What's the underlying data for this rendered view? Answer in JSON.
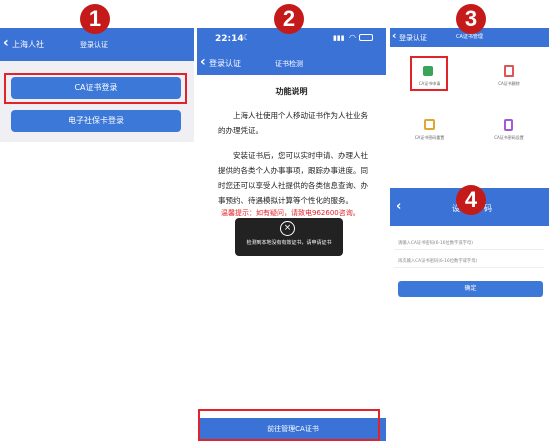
{
  "colors": {
    "primary": "#3b72d6",
    "danger": "#e2232a",
    "badge": "#c51a1a",
    "toast_bg": "#222222"
  },
  "step_badges": [
    "1",
    "2",
    "3",
    "4"
  ],
  "panel1": {
    "back_label": "上海人社",
    "title": "登录认证",
    "buttons": [
      "CA证书登录",
      "电子社保卡登录"
    ]
  },
  "panel2": {
    "time": "22:14",
    "back_label": "登录认证",
    "title": "证书检测",
    "heading": "功能说明",
    "para1": "上海人社使用个人移动证书作为人社业务的办理凭证。",
    "para2": "安装证书后，您可以实时申请、办理人社提供的各类个人办事事项，跟踪办事进度。同时您还可以享受人社提供的各类信息查询、办事预约、待遇模拟计算等个性化的服务。",
    "hint": "温馨提示：如有疑问，请致电962600咨询。",
    "toast": "检测到本地没有有效证书，请申请证书",
    "bottom_button": "前往管理CA证书"
  },
  "panel3": {
    "back_label": "登录认证",
    "title": "CA证书管理",
    "tiles": [
      {
        "label": "CA证书申请",
        "icon": "certificate-apply-icon",
        "color": "#3aa55a"
      },
      {
        "label": "CA证书删除",
        "icon": "trash-icon",
        "color": "#e05555"
      },
      {
        "label": "CA证书密码重置",
        "icon": "password-reset-icon",
        "color": "#e0a630"
      },
      {
        "label": "CA证书密码设置",
        "icon": "password-set-icon",
        "color": "#a45ad6"
      }
    ]
  },
  "panel4": {
    "title_left": "设",
    "title_right": "码",
    "input1_placeholder": "请输入CA证书密码(6-16位数字或字母)",
    "input2_placeholder": "再次输入CA证书密码(6-16位数字或字母)",
    "confirm": "确定"
  }
}
